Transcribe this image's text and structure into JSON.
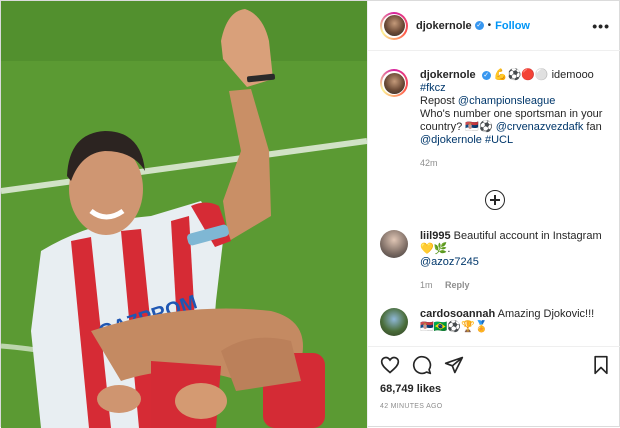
{
  "post": {
    "username": "djokernole",
    "follow_label": "Follow",
    "more_label": "•••",
    "caption": {
      "username": "djokernole",
      "emojis": "💪⚽🔴⚪",
      "text1": "idemooo",
      "hashtag1": "#fkcz",
      "repost": "Repost",
      "mention1": "@championsleague",
      "question": "Who's number one sportsman in your country?",
      "emojis2": "🇷🇸⚽",
      "mention2": "@crvenazvezdafk",
      "fan": "fan",
      "mention3": "@djokernole",
      "hashtag2": "#UCL",
      "time": "42m"
    },
    "comments": [
      {
        "username": "liil995",
        "text": "Beautiful account in Instagram",
        "emojis": "💛🌿.",
        "mention": "@azoz7245",
        "time": "1m",
        "reply_label": "Reply"
      },
      {
        "username": "cardosoannah",
        "text": "Amazing Djokovic!!!",
        "emojis": "🇷🇸🇧🇷⚽🏆🏅"
      }
    ],
    "likes": "68,749 likes",
    "posted_ago": "42 MINUTES AGO"
  },
  "colors": {
    "accent": "#0095f6",
    "verified": "#3897f0",
    "muted": "#8e8e8e",
    "text": "#262626"
  }
}
